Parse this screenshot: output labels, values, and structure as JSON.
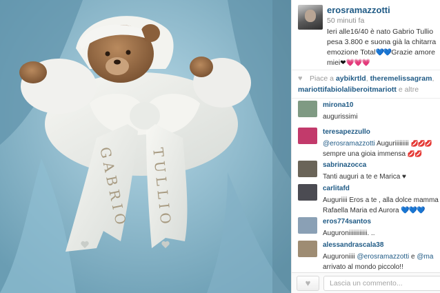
{
  "post": {
    "username": "erosramazzotti",
    "time": "50 minuti fa",
    "caption_lines": [
      "Ieri alle16/40 è nato Gabrio Tullio",
      "pesa 3.800 e suona già la chitarra",
      "emozione Total",
      "Grazie amore",
      "miei"
    ],
    "hearts_blue": "💙💙",
    "hearts_black": "❤",
    "hearts_pink": "💗💗💗"
  },
  "photo": {
    "embroidery_left": "GABRIO",
    "embroidery_right": "TULLIO"
  },
  "likes": {
    "prefix": "Piace a",
    "likers": [
      "aybikrtld",
      "theremelissagram",
      "mariottifabiolaliberoitmariott"
    ],
    "suffix": "e altre"
  },
  "comments": [
    {
      "user": "mirona10",
      "text": "augurissimi",
      "avatar_color": "#7f9a83"
    },
    {
      "user": "teresapezzullo",
      "mention": "@erosramazzotti",
      "text": "Auguriiiiiiiii",
      "text2": "sempre una gioia immensa",
      "lips": "💋💋💋",
      "lips2": "💋💋",
      "avatar_color": "#c23a6b"
    },
    {
      "user": "sabrinazocca",
      "text": "Tanti auguri a te e Marica ♥",
      "avatar_color": "#6a6458"
    },
    {
      "user": "carlitafd",
      "text": "Auguriiii Eros a te , alla dolce mamma",
      "text2": "Rafaella Maria ed Aurora",
      "hearts": "💙💙💙",
      "avatar_color": "#4b4b52"
    },
    {
      "user": "eros774santos",
      "text": "Auguroniiiiiiiiiiii. ..",
      "avatar_color": "#8aa0b5"
    },
    {
      "user": "alessandrascala38",
      "text": "Auguroniiii",
      "mention": "@erosramazzotti",
      "text_mid": "e",
      "mention2": "@ma",
      "text2": "arrivato al mondo piccolo!!",
      "avatar_color": "#9e8c73"
    }
  ],
  "footer": {
    "like_icon": "heart-icon",
    "comment_placeholder": "Lascia un commento..."
  }
}
